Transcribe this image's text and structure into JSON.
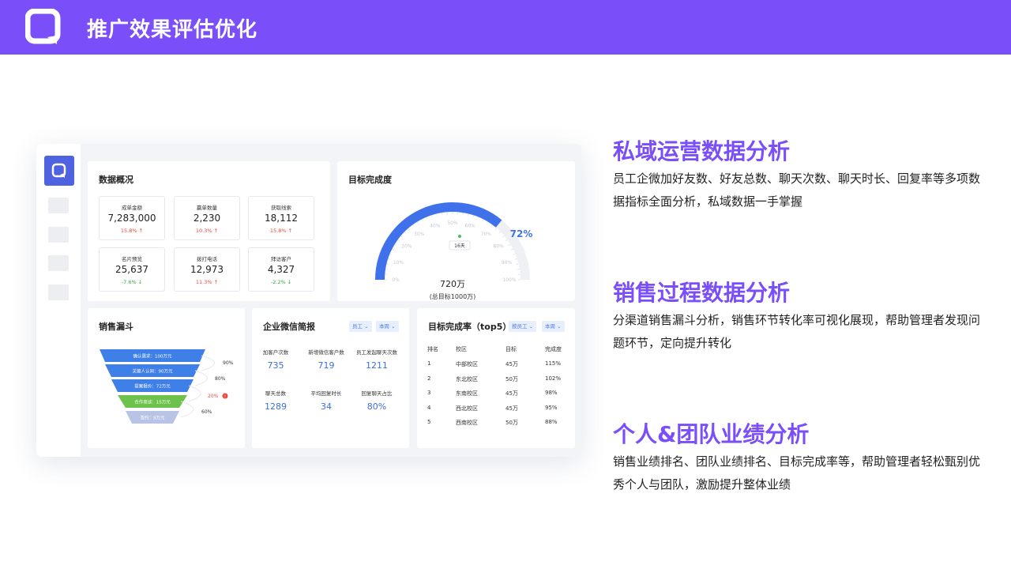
{
  "header": {
    "title": "推广效果评估优化",
    "color": "#7a4ef9"
  },
  "dashboard": {
    "overview": {
      "title": "数据概况",
      "metrics": [
        {
          "label": "成单金额",
          "value": "7,283,000",
          "change": "15.8%",
          "trend": "up"
        },
        {
          "label": "赢单数量",
          "value": "2,230",
          "change": "10.3%",
          "trend": "up"
        },
        {
          "label": "获取线索",
          "value": "18,112",
          "change": "15.8%",
          "trend": "up"
        },
        {
          "label": "名片预览",
          "value": "25,637",
          "change": "-7.6%",
          "trend": "down"
        },
        {
          "label": "拨打电话",
          "value": "12,973",
          "change": "11.3%",
          "trend": "up"
        },
        {
          "label": "拜访客户",
          "value": "4,327",
          "change": "-2.2%",
          "trend": "down"
        }
      ]
    },
    "goal": {
      "title": "目标完成度",
      "percent": "72%",
      "progress": 0.72,
      "amount": "720万",
      "subtitle": "(总目标1000万)",
      "marker": "16天",
      "ticks": [
        "0%",
        "10%",
        "20%",
        "30%",
        "40%",
        "50%",
        "60%",
        "70%",
        "80%",
        "90%",
        "100%"
      ]
    },
    "funnel": {
      "title": "销售漏斗",
      "stages": [
        {
          "label": "确认需求：100万元",
          "color": "#3f7fe8"
        },
        {
          "label": "关键人认同：90万元",
          "color": "#3f7fe8"
        },
        {
          "label": "提案报价：72万元",
          "color": "#3f7fe8"
        },
        {
          "label": "合作商谈：15万元",
          "color": "#6cc24a"
        },
        {
          "label": "签约：9万元",
          "color": "#b8c3e6"
        }
      ],
      "rates": [
        {
          "text": "90%",
          "alert": false
        },
        {
          "text": "80%",
          "alert": false
        },
        {
          "text": "20%",
          "alert": true
        },
        {
          "text": "60%",
          "alert": false
        }
      ]
    },
    "wechat": {
      "title": "企业微信简报",
      "filter1": "员工",
      "filter2": "本周",
      "kpis": [
        {
          "label": "加客户次数",
          "value": "735"
        },
        {
          "label": "新增微信客户数",
          "value": "719"
        },
        {
          "label": "员工发起聊天次数",
          "value": "1211"
        },
        {
          "label": "聊天总数",
          "value": "1289"
        },
        {
          "label": "平均回复时长",
          "value": "34"
        },
        {
          "label": "回复聊天占比",
          "value": "80%"
        }
      ]
    },
    "ranking": {
      "title": "目标完成率（top5）",
      "filter1": "按员工",
      "filter2": "本周",
      "headers": [
        "排名",
        "校区",
        "目标",
        "完成度"
      ],
      "rows": [
        [
          "1",
          "中部校区",
          "45万",
          "115%"
        ],
        [
          "2",
          "东北校区",
          "50万",
          "102%"
        ],
        [
          "3",
          "东南校区",
          "45万",
          "98%"
        ],
        [
          "4",
          "西北校区",
          "45万",
          "95%"
        ],
        [
          "5",
          "西南校区",
          "50万",
          "88%"
        ]
      ]
    }
  },
  "sections": [
    {
      "title": "私域运营数据分析",
      "desc": "员工企微加好友数、好友总数、聊天次数、聊天时长、回复率等多项数据指标全面分析，私域数据一手掌握"
    },
    {
      "title": "销售过程数据分析",
      "desc": "分渠道销售漏斗分析，销售环节转化率可视化展现，帮助管理者发现问题环节，定向提升转化"
    },
    {
      "title": "个人&团队业绩分析",
      "desc": "销售业绩排名、团队业绩排名、目标完成率等，帮助管理者轻松甄别优秀个人与团队，激励提升整体业绩"
    }
  ]
}
